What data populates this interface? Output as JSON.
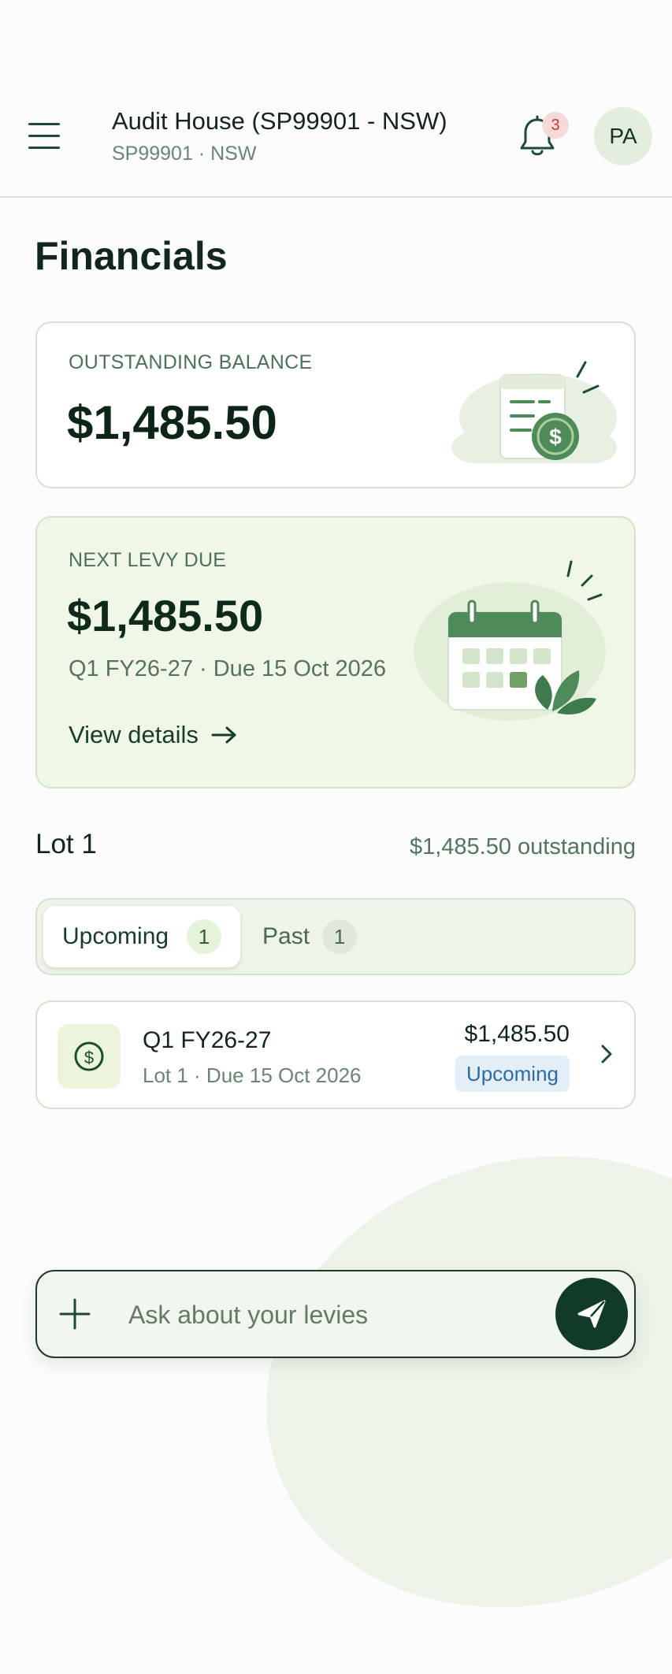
{
  "header": {
    "title": "Audit House (SP99901 - NSW)",
    "subtitle": "SP99901 · NSW",
    "notification_count": "3",
    "avatar_initials": "PA"
  },
  "page": {
    "title": "Financials"
  },
  "balance_card": {
    "label": "OUTSTANDING BALANCE",
    "amount": "$1,485.50",
    "illustration": "invoice-dollar-icon"
  },
  "levy_card": {
    "label": "NEXT LEVY DUE",
    "amount": "$1,485.50",
    "subtitle": "Q1 FY26-27 · Due 15 Oct 2026",
    "link_label": "View details",
    "illustration": "calendar-plant-icon"
  },
  "lot": {
    "title": "Lot 1",
    "outstanding": "$1,485.50 outstanding"
  },
  "tabs": [
    {
      "label": "Upcoming",
      "count": "1",
      "active": true
    },
    {
      "label": "Past",
      "count": "1",
      "active": false
    }
  ],
  "levies": [
    {
      "title": "Q1 FY26-27",
      "subtitle": "Lot 1 · Due 15 Oct 2026",
      "amount": "$1,485.50",
      "status": "Upcoming",
      "icon": "dollar-circle-icon"
    }
  ],
  "chat": {
    "placeholder": "Ask about your levies"
  },
  "colors": {
    "primary_dark": "#113b27",
    "accent_green": "#4f8a5a",
    "levy_card_bg": "#f1f7e7",
    "status_badge_bg": "#e4eef7",
    "status_badge_text": "#2c6ca6",
    "notification_badge": "#c73737"
  }
}
